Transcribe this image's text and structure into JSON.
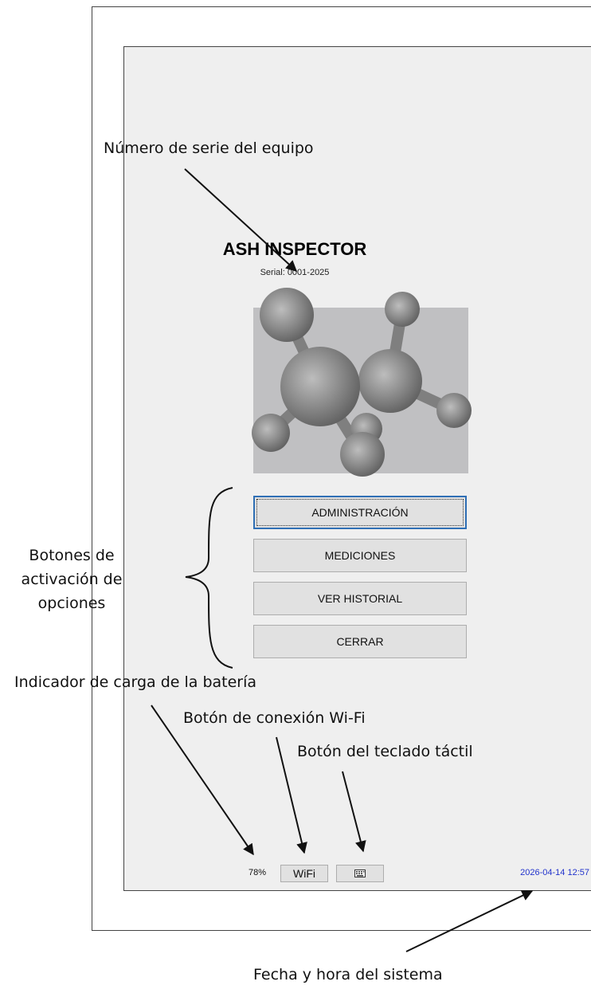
{
  "app": {
    "title": "ASH INSPECTOR",
    "serial": "Serial: 0001-2025"
  },
  "menu": {
    "buttons": [
      "ADMINISTRACIÓN",
      "MEDICIONES",
      "VER HISTORIAL",
      "CERRAR"
    ]
  },
  "status_bar": {
    "battery": "78%",
    "wifi_label": "WiFi",
    "keyboard_icon": "keyboard-icon",
    "datetime": "2026-04-14  12:57"
  },
  "annotations": {
    "serial_number": "Número de serie del equipo",
    "option_buttons_line1": "Botones de",
    "option_buttons_line2": "activación de",
    "option_buttons_line3": "opciones",
    "battery_indicator": "Indicador de carga de la batería",
    "wifi_button": "Botón de conexión Wi-Fi",
    "keyboard_button": "Botón del teclado táctil",
    "datetime": "Fecha y hora del sistema"
  },
  "colors": {
    "screen_bg": "#efefef",
    "button_bg": "#e1e1e1",
    "focus_border": "#2f6fb5",
    "datetime_text": "#2233cc"
  }
}
